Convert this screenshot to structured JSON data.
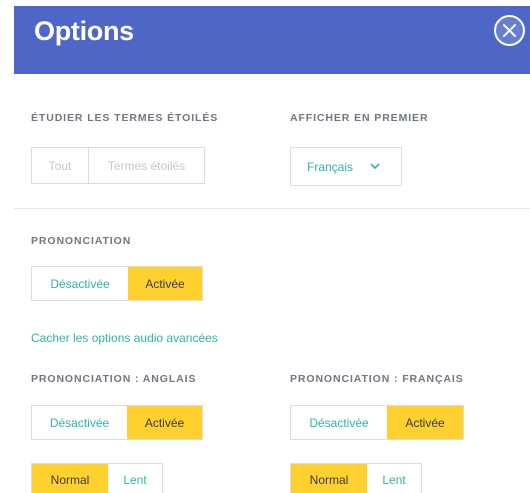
{
  "header": {
    "title": "Options",
    "close_icon": "close-icon",
    "background": "#4e66c6"
  },
  "study_starred": {
    "label": "ÉTUDIER LES TERMES ÉTOILÉS",
    "options": [
      "Tout",
      "Termes étoilés"
    ],
    "enabled": false
  },
  "show_first": {
    "label": "AFFICHER EN PREMIER",
    "value": "Français",
    "icon": "chevron-down-icon"
  },
  "pronunciation": {
    "label": "PRONONCIATION",
    "options": [
      "Désactivée",
      "Activée"
    ],
    "selected": "Activée"
  },
  "audio_link": {
    "label": "Cacher les options audio avancées"
  },
  "pron_english": {
    "label": "PRONONCIATION : ANGLAIS",
    "options": [
      "Désactivée",
      "Activée"
    ],
    "selected": "Activée",
    "speed_options": [
      "Normal",
      "Lent"
    ],
    "speed_selected": "Normal"
  },
  "pron_french": {
    "label": "PRONONCIATION : FRANÇAIS",
    "options": [
      "Désactivée",
      "Activée"
    ],
    "selected": "Activée",
    "speed_options": [
      "Normal",
      "Lent"
    ],
    "speed_selected": "Normal"
  },
  "colors": {
    "accent_yellow": "#ffd12e",
    "accent_teal": "#2fb3a8",
    "label_grey": "#6f7780"
  }
}
